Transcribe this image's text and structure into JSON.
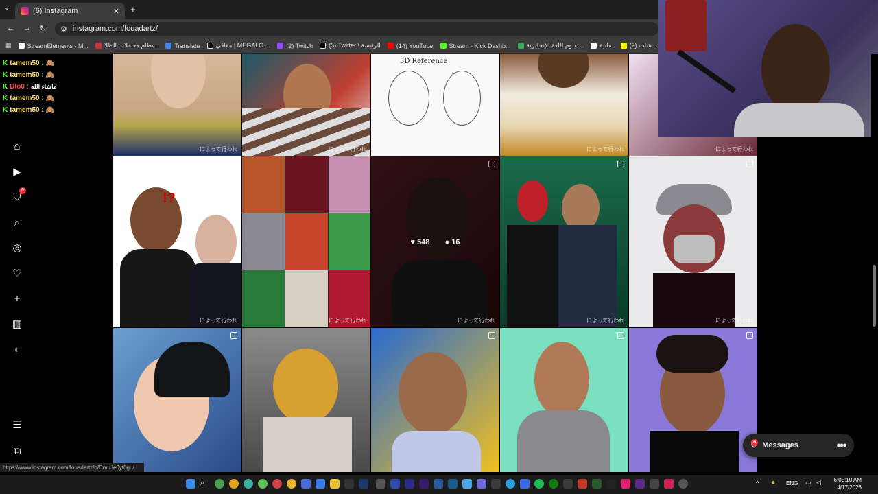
{
  "browser": {
    "tab_title": "(6) Instagram",
    "tab_close": "✕",
    "new_tab": "+",
    "url": "instagram.com/fouadartz/",
    "bookmarks": [
      "StreamElements - M...",
      "نظام معاملات الطلا...",
      "Translate",
      "مقاقي | MEGALO ...",
      "(2) Twitch",
      "(5) Twitter \\ الرئيسة",
      "(14) YouTube",
      "Stream - Kick Dashb...",
      "دبلوم اللغة الإنجليزية...",
      "تمانية",
      "(2) سناب شات"
    ]
  },
  "chat": [
    {
      "user": "tamem50 :",
      "emote": "🙈"
    },
    {
      "user": "tamem50 :",
      "emote": "🙈"
    },
    {
      "user": "Dlo0 :",
      "emote": "ماشاء الله"
    },
    {
      "user": "tamem50 :",
      "emote": "🙈"
    },
    {
      "user": "tamem50 :",
      "emote": "🙈"
    }
  ],
  "nav": {
    "notification_count": "6"
  },
  "grid": {
    "watermark": "によって行われ",
    "hovered": {
      "likes": "548",
      "comments": "16"
    },
    "reference_label": "3D Reference"
  },
  "messages": {
    "label": "Messages",
    "badge": "6"
  },
  "status_url": "https://www.instagram.com/fouadartz/p/CmuJe0yt0gu/",
  "taskbar": {
    "lang": "ENG",
    "time": "6:05:10 AM",
    "date": "4/17/2026"
  },
  "colors": {
    "accent": "#ff3040",
    "kick_green": "#53fc18",
    "chrome_bg": "#3c3c3c"
  }
}
